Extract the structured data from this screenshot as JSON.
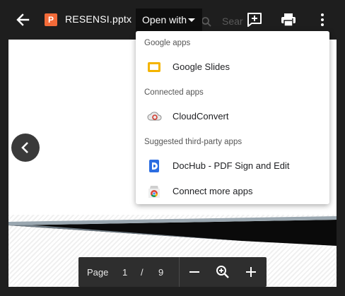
{
  "header": {
    "file_name": "RESENSI.pptx",
    "file_icon_letter": "P",
    "open_with_label": "Open with",
    "background_text": "Sear"
  },
  "menu": {
    "sections": [
      {
        "title": "Google apps",
        "items": [
          {
            "label": "Google Slides",
            "icon": "google-slides-icon"
          }
        ]
      },
      {
        "title": "Connected apps",
        "items": [
          {
            "label": "CloudConvert",
            "icon": "cloudconvert-icon"
          }
        ]
      },
      {
        "title": "Suggested third-party apps",
        "items": [
          {
            "label": "DocHub - PDF Sign and Edit",
            "icon": "dochub-icon"
          },
          {
            "label": "Connect more apps",
            "icon": "chrome-web-store-icon"
          }
        ]
      }
    ]
  },
  "pager": {
    "label": "Page",
    "current": "1",
    "separator": "/",
    "total": "9"
  },
  "colors": {
    "file_icon": "#f36b39",
    "slides_yellow": "#f4b400",
    "dochub_blue": "#2c6de1"
  }
}
